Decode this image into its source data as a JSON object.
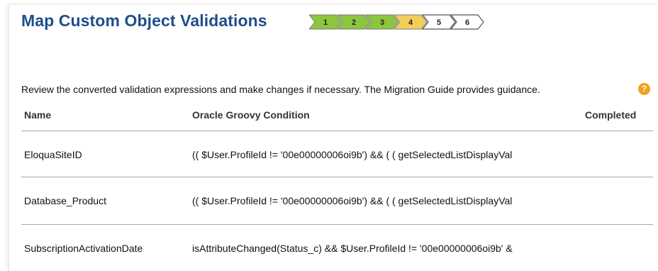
{
  "page": {
    "title": "Map Custom Object Validations",
    "instructions": "Review the converted validation expressions and make changes if necessary. The Migration Guide provides guidance.",
    "help_icon_glyph": "?"
  },
  "train": {
    "steps": [
      {
        "label": "1",
        "state": "completed"
      },
      {
        "label": "2",
        "state": "completed"
      },
      {
        "label": "3",
        "state": "completed"
      },
      {
        "label": "4",
        "state": "current"
      },
      {
        "label": "5",
        "state": "upcoming"
      },
      {
        "label": "6",
        "state": "upcoming"
      }
    ],
    "colors": {
      "completed": "#8cc63f",
      "current": "#f5cd5a",
      "upcoming": "#ffffff"
    }
  },
  "table": {
    "headers": {
      "name": "Name",
      "condition": "Oracle Groovy Condition",
      "completed": "Completed"
    },
    "rows": [
      {
        "name": "EloquaSiteID",
        "condition": "(( $User.ProfileId != '00e00000006oi9b') && ( ( getSelectedListDisplayVal",
        "completed": ""
      },
      {
        "name": "Database_Product",
        "condition": "(( $User.ProfileId != '00e00000006oi9b') && ( ( getSelectedListDisplayVal",
        "completed": ""
      },
      {
        "name": "SubscriptionActivationDate",
        "condition": "isAttributeChanged(Status_c) && $User.ProfileId != '00e00000006oi9b' &",
        "completed": ""
      }
    ]
  }
}
